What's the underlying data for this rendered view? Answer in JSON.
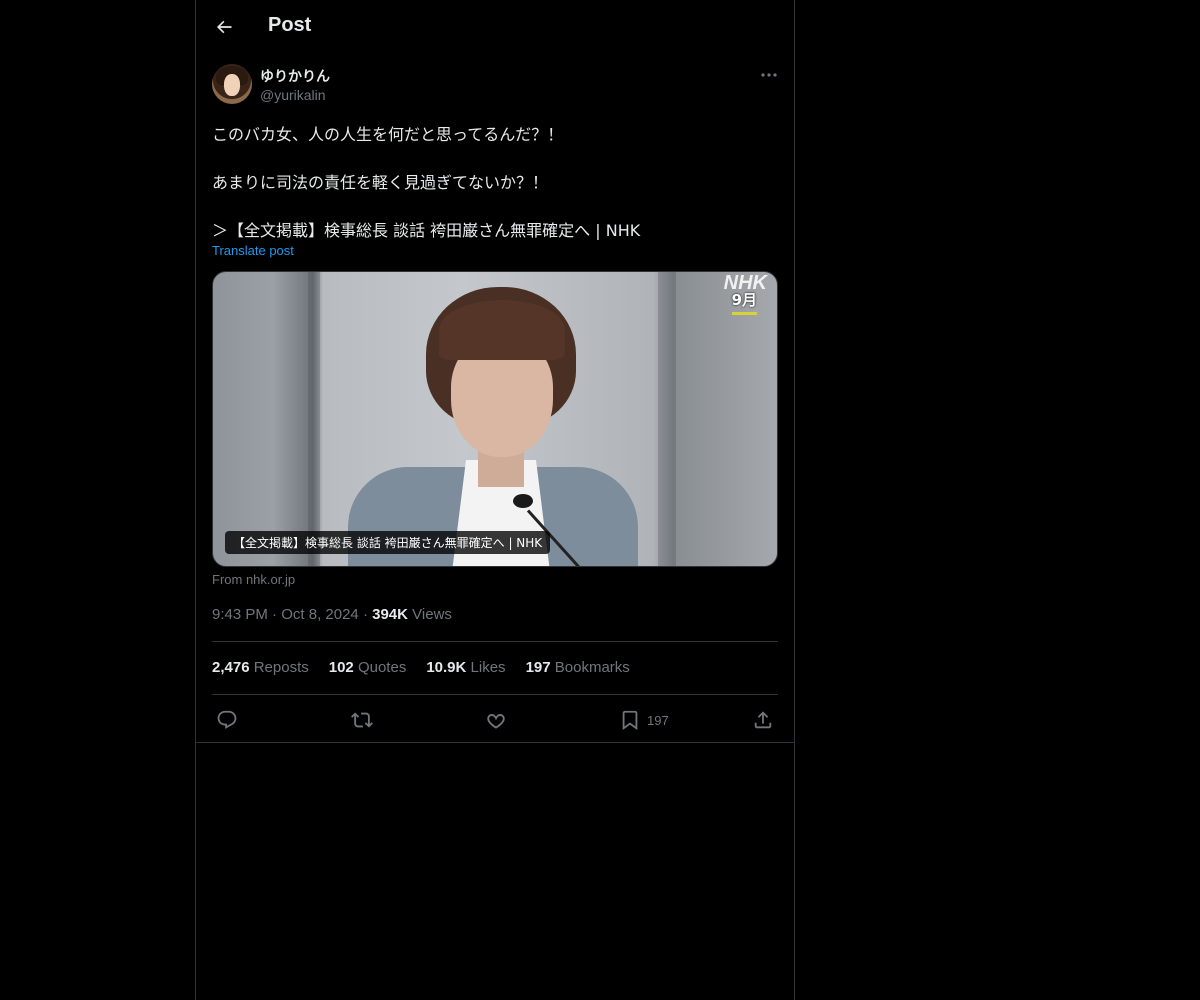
{
  "header": {
    "title": "Post"
  },
  "author": {
    "display_name": "ゆりかりん",
    "handle": "@yurikalin"
  },
  "post": {
    "lines": [
      "このバカ女、人の人生を何だと思ってるんだ？！",
      "あまりに司法の責任を軽く見過ぎてないか？！",
      "＞【全文掲載】検事総長 談話 袴田巌さん無罪確定へ | NHK"
    ],
    "translate_label": "Translate post"
  },
  "media": {
    "logo_text": "NHK",
    "month_label": "9月",
    "caption": "【全文掲載】検事総長 談話 袴田巌さん無罪確定へ | NHK",
    "source": "From nhk.or.jp"
  },
  "meta": {
    "time": "9:43 PM",
    "sep1": "·",
    "date": "Oct 8, 2024",
    "sep2": "·",
    "views_count": "394K",
    "views_label": "Views"
  },
  "stats": {
    "reposts": {
      "count": "2,476",
      "label": "Reposts"
    },
    "quotes": {
      "count": "102",
      "label": "Quotes"
    },
    "likes": {
      "count": "10.9K",
      "label": "Likes"
    },
    "bookmarks": {
      "count": "197",
      "label": "Bookmarks"
    }
  },
  "actions": {
    "reply": {
      "icon": "reply-icon"
    },
    "repost": {
      "icon": "repost-icon"
    },
    "like": {
      "icon": "heart-icon"
    },
    "bookmark": {
      "icon": "bookmark-icon",
      "count": "197"
    },
    "share": {
      "icon": "share-icon"
    }
  },
  "colors": {
    "background": "#000000",
    "text": "#e7e9ea",
    "muted": "#71767b",
    "accent": "#1d9bf0",
    "border": "#2f3336"
  }
}
